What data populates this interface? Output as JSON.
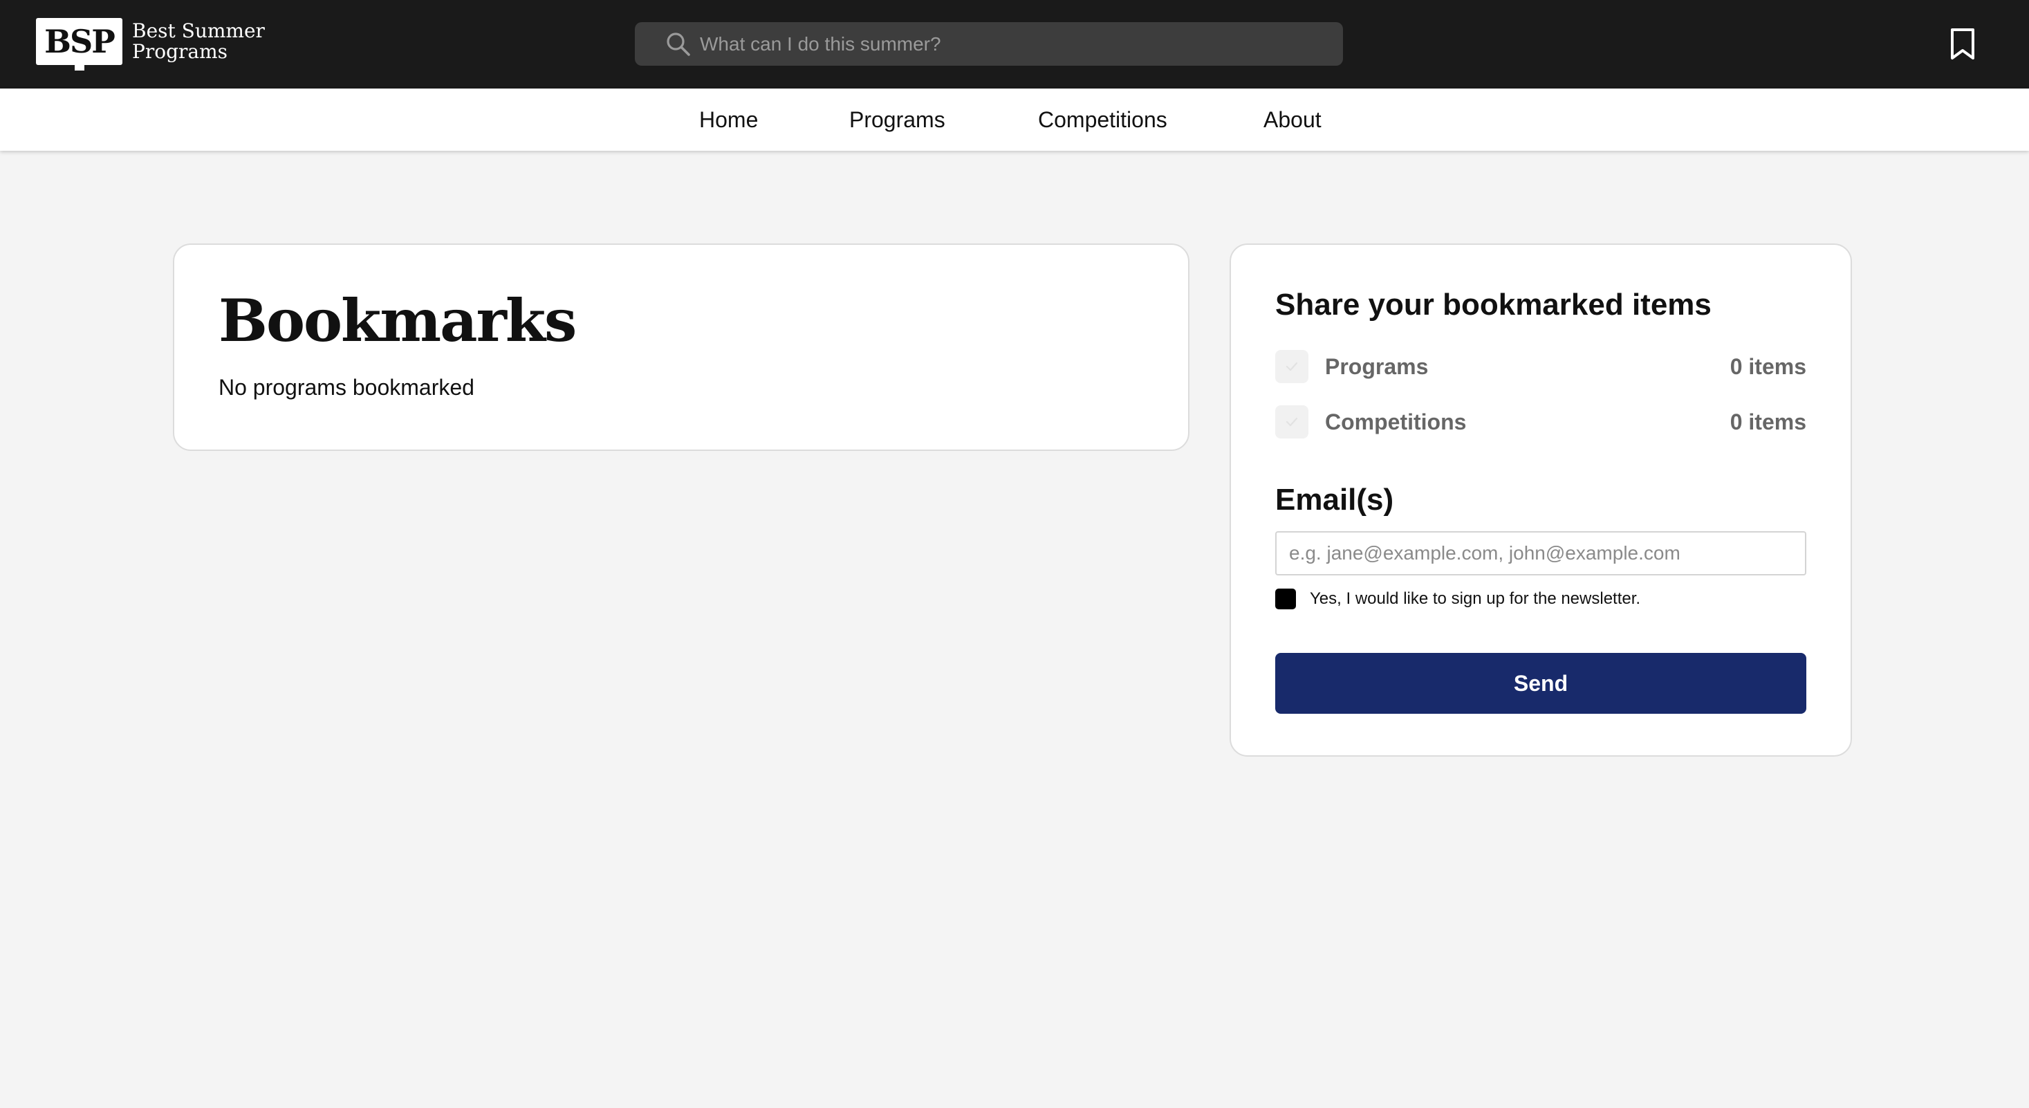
{
  "brand": {
    "logo_mark": "BSP",
    "name_line1": "Best Summer",
    "name_line2": "Programs"
  },
  "header": {
    "search_placeholder": "What can I do this summer?",
    "search_icon": "search-icon",
    "bookmarks_icon": "bookmark-icon"
  },
  "nav": {
    "items": [
      {
        "label": "Home"
      },
      {
        "label": "Programs"
      },
      {
        "label": "Competitions"
      },
      {
        "label": "About"
      }
    ]
  },
  "bookmarks": {
    "title": "Bookmarks",
    "empty_message": "No programs bookmarked"
  },
  "share": {
    "title": "Share your bookmarked items",
    "options": [
      {
        "label": "Programs",
        "count": "0 items",
        "checked": true,
        "disabled": true
      },
      {
        "label": "Competitions",
        "count": "0 items",
        "checked": true,
        "disabled": true
      }
    ],
    "email_label": "Email(s)",
    "email_placeholder": "e.g. jane@example.com, john@example.com",
    "email_value": "",
    "newsletter_label": "Yes, I would like to sign up for the newsletter.",
    "newsletter_checked": true,
    "send_label": "Send"
  },
  "colors": {
    "header_bg": "#1a1a1a",
    "search_bg": "#3d3d3d",
    "page_bg": "#f4f4f4",
    "send_button": "#182a6b",
    "muted_text": "#666666"
  }
}
